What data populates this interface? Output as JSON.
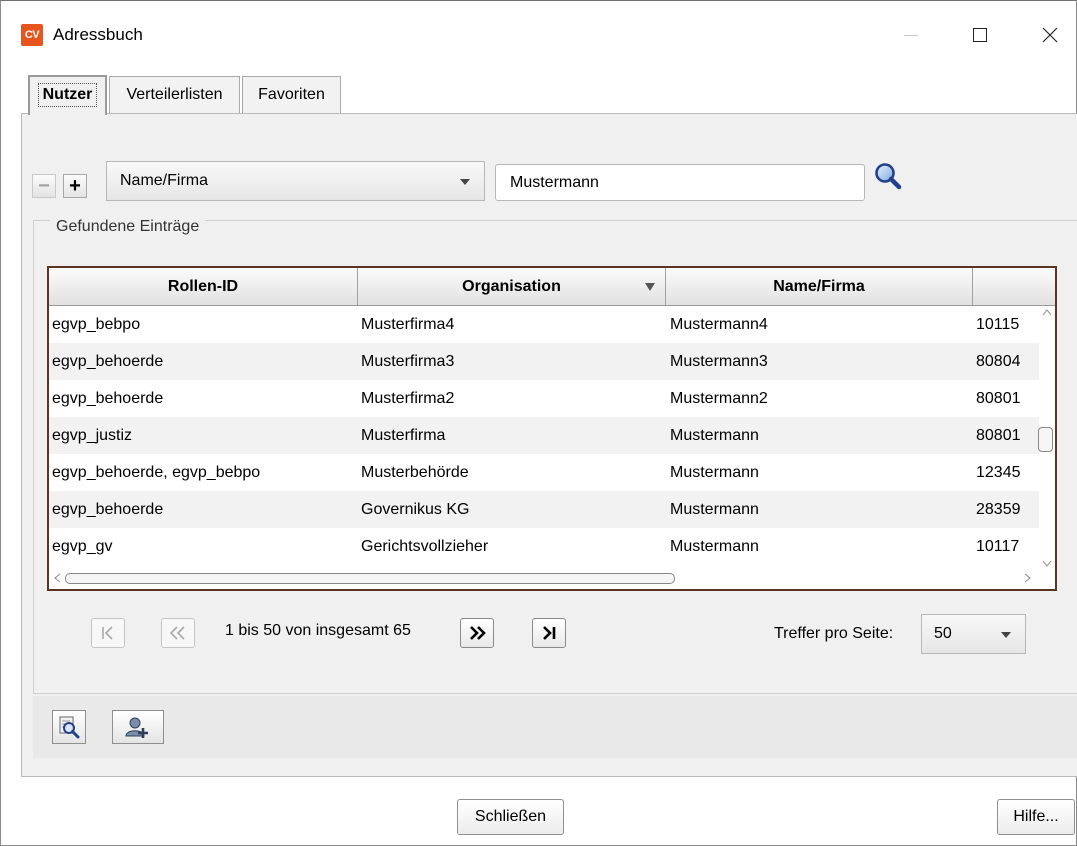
{
  "window": {
    "app_logo": "CV",
    "title": "Adressbuch",
    "brand_color": "#e8541e"
  },
  "tabs": [
    {
      "label": "Nutzer",
      "active": true
    },
    {
      "label": "Verteilerlisten",
      "active": false
    },
    {
      "label": "Favoriten",
      "active": false
    }
  ],
  "filter": {
    "remove_label": "−",
    "add_label": "+",
    "field_selected": "Name/Firma",
    "search_value": "Mustermann"
  },
  "results": {
    "group_label": "Gefundene Einträge",
    "columns": [
      "Rollen-ID",
      "Organisation",
      "Name/Firma",
      ""
    ],
    "rows": [
      [
        "egvp_bebpo",
        "Musterfirma4",
        "Mustermann4",
        "10115"
      ],
      [
        "egvp_behoerde",
        "Musterfirma3",
        "Mustermann3",
        "80804"
      ],
      [
        "egvp_behoerde",
        "Musterfirma2",
        "Mustermann2",
        "80801"
      ],
      [
        "egvp_justiz",
        "Musterfirma",
        "Mustermann",
        "80801"
      ],
      [
        "egvp_behoerde, egvp_bebpo",
        "Musterbehörde",
        "Mustermann",
        "12345"
      ],
      [
        "egvp_behoerde",
        "Governikus KG",
        "Mustermann",
        "28359"
      ],
      [
        "egvp_gv",
        "Gerichtsvollzieher",
        "Mustermann",
        "10117"
      ]
    ]
  },
  "pagination": {
    "info": "1 bis 50 von insgesamt 65",
    "per_page_label": "Treffer pro Seite:",
    "per_page_value": "50"
  },
  "footer": {
    "close_label": "Schließen",
    "help_label": "Hilfe..."
  }
}
